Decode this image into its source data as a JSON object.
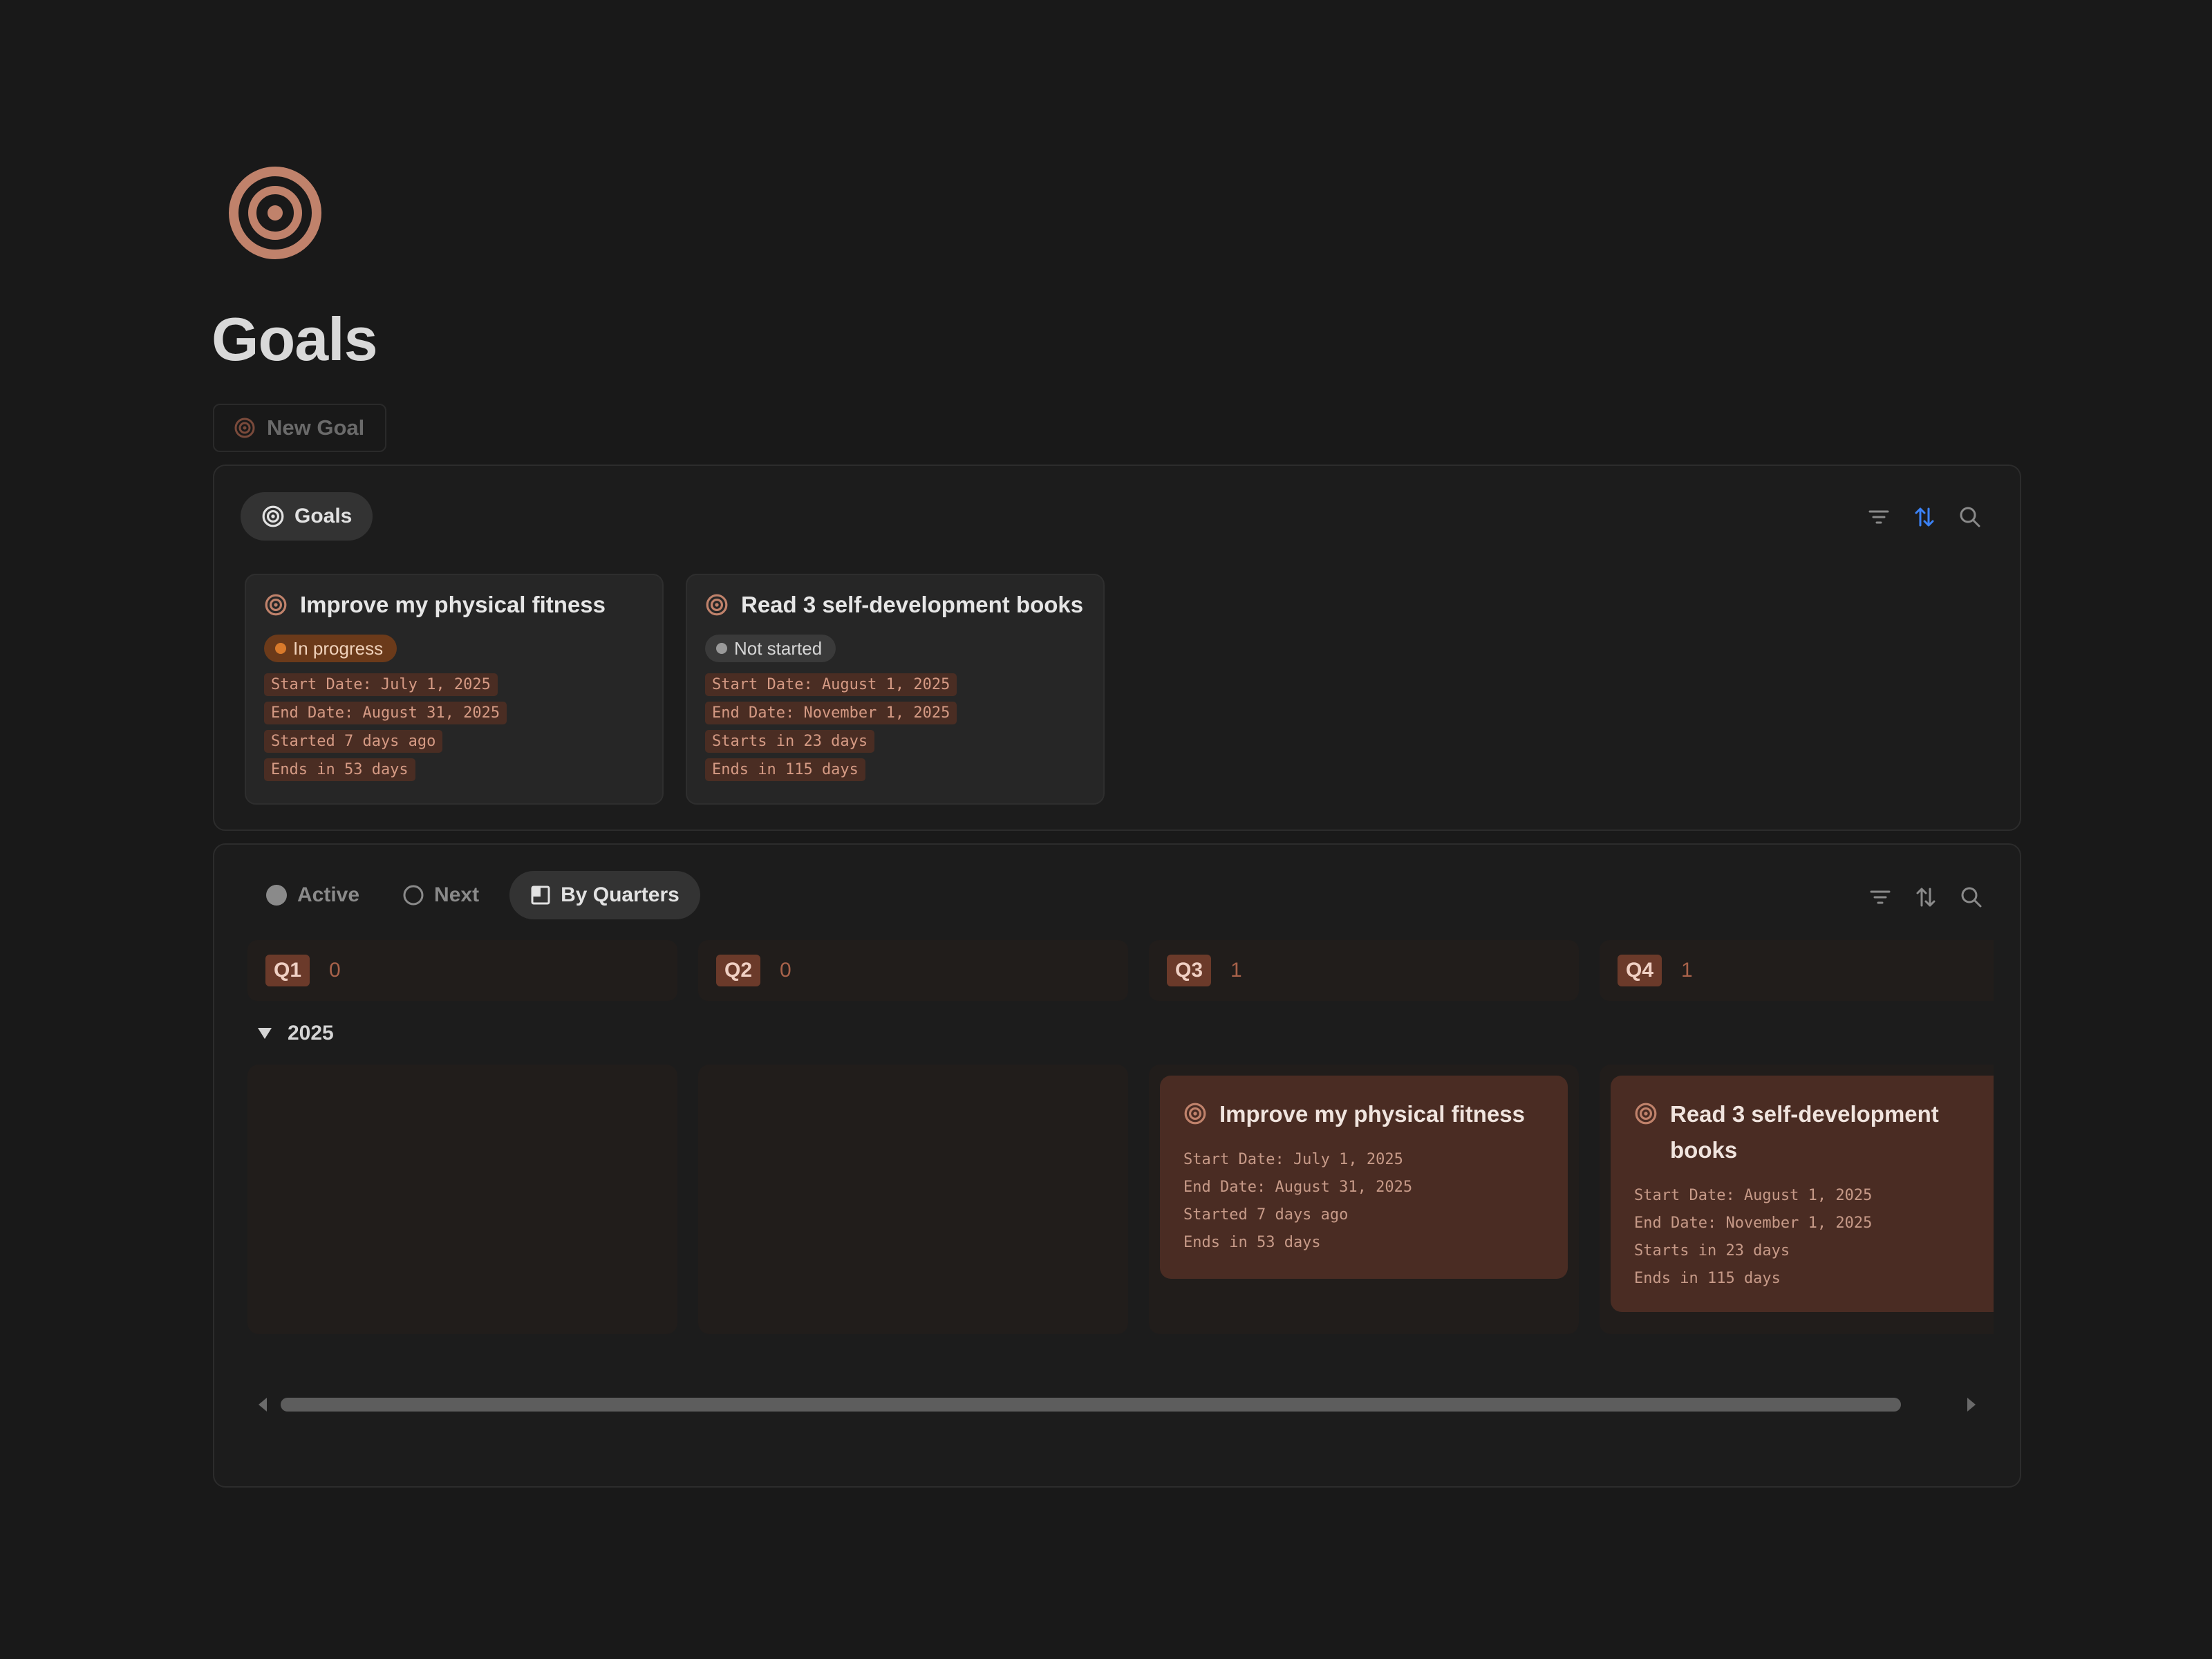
{
  "page": {
    "title": "Goals",
    "new_goal_label": "New Goal"
  },
  "gallery_view": {
    "tab_label": "Goals",
    "cards": [
      {
        "title": "Improve my physical fitness",
        "status": "In progress",
        "status_color": "#d97a2b",
        "status_bg": "#6b3a1a",
        "start": "Start Date: July 1, 2025",
        "end": "End Date: August 31, 2025",
        "started": "Started 7 days ago",
        "ends": "Ends in 53 days"
      },
      {
        "title": "Read 3 self-development books",
        "status": "Not started",
        "status_color": "#9a9a9a",
        "status_bg": "#3a3a3a",
        "start": "Start Date: August 1, 2025",
        "end": "End Date: November 1, 2025",
        "started": "Starts in 23 days",
        "ends": "Ends in 115 days"
      }
    ]
  },
  "board_view": {
    "tabs": [
      {
        "label": "Active"
      },
      {
        "label": "Next"
      },
      {
        "label": "By Quarters"
      }
    ],
    "columns": [
      {
        "label": "Q1",
        "count": "0"
      },
      {
        "label": "Q2",
        "count": "0"
      },
      {
        "label": "Q3",
        "count": "1"
      },
      {
        "label": "Q4",
        "count": "1"
      }
    ],
    "group_label": "2025",
    "q3_card": {
      "title": "Improve my physical fitness",
      "start": "Start Date: July 1, 2025",
      "end": "End Date: August 31, 2025",
      "started": "Started 7 days ago",
      "ends": "Ends in 53 days"
    },
    "q4_card": {
      "title": "Read 3 self-development books",
      "start": "Start Date: August 1, 2025",
      "end": "End Date: November 1, 2025",
      "started": "Starts in 23 days",
      "ends": "Ends in 115 days"
    }
  },
  "colors": {
    "background": "#191919",
    "accent": "#c0826b",
    "sort_active": "#3b82f6",
    "tag_bg": "#4a2d23",
    "tag_text": "#d59a84"
  },
  "icons": [
    "target-icon",
    "filter-icon",
    "sort-icon",
    "search-icon",
    "board-icon",
    "chevron-down-icon",
    "scroll-left-icon",
    "scroll-right-icon"
  ]
}
